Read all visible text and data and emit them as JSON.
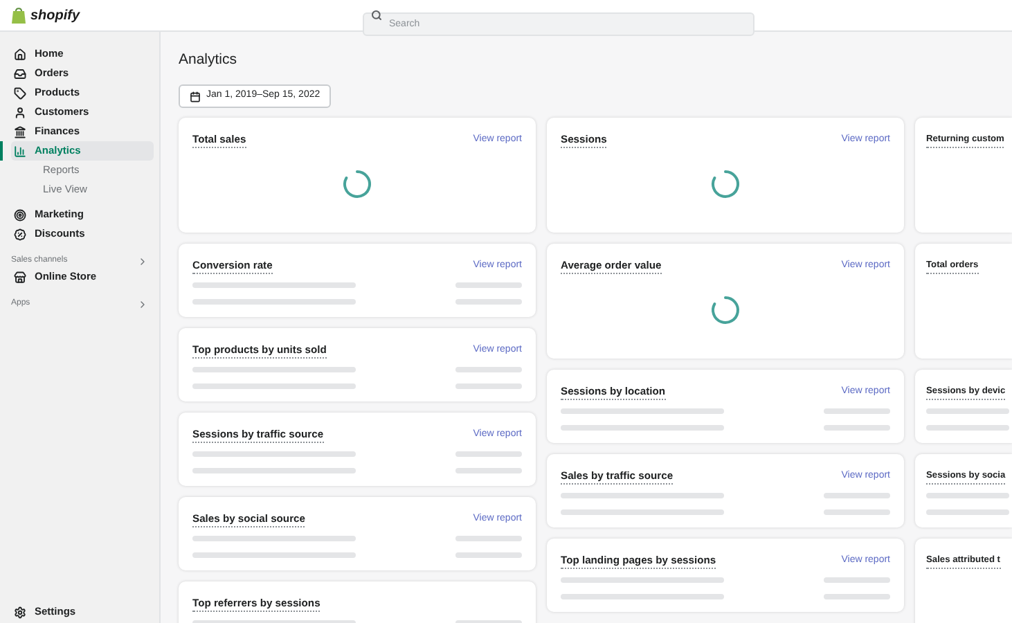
{
  "brand": "shopify",
  "search": {
    "placeholder": "Search"
  },
  "sidebar": {
    "items": [
      {
        "label": "Home",
        "selected": false
      },
      {
        "label": "Orders",
        "selected": false
      },
      {
        "label": "Products",
        "selected": false
      },
      {
        "label": "Customers",
        "selected": false
      },
      {
        "label": "Finances",
        "selected": false
      },
      {
        "label": "Analytics",
        "selected": true,
        "children": [
          {
            "label": "Reports"
          },
          {
            "label": "Live View"
          }
        ]
      },
      {
        "label": "Marketing",
        "selected": false
      },
      {
        "label": "Discounts",
        "selected": false
      }
    ],
    "sales_channels": {
      "label": "Sales channels",
      "items": [
        {
          "label": "Online Store"
        }
      ]
    },
    "apps": {
      "label": "Apps"
    },
    "settings": {
      "label": "Settings"
    }
  },
  "page": {
    "title": "Analytics",
    "date_range": "Jan 1, 2019–Sep 15, 2022"
  },
  "columns": [
    [
      {
        "title": "Total sales",
        "kind": "loading",
        "link": "View report"
      },
      {
        "title": "Conversion rate",
        "kind": "skeleton",
        "link": "View report"
      },
      {
        "title": "Top products by units sold",
        "kind": "skeleton",
        "link": "View report"
      },
      {
        "title": "Sessions by traffic source",
        "kind": "skeleton",
        "link": "View report"
      },
      {
        "title": "Sales by social source",
        "kind": "skeleton",
        "link": "View report"
      },
      {
        "title": "Top referrers by sessions",
        "kind": "skeleton"
      }
    ],
    [
      {
        "title": "Sessions",
        "kind": "loading",
        "link": "View report"
      },
      {
        "title": "Average order value",
        "kind": "loading",
        "link": "View report"
      },
      {
        "title": "Sessions by location",
        "kind": "skeleton",
        "link": "View report"
      },
      {
        "title": "Sales by traffic source",
        "kind": "skeleton",
        "link": "View report"
      },
      {
        "title": "Top landing pages by sessions",
        "kind": "skeleton",
        "link": "View report"
      }
    ],
    [
      {
        "title": "Returning custom",
        "kind": "blank"
      },
      {
        "title": "Total orders",
        "kind": "blank"
      },
      {
        "title": "Sessions by devic",
        "kind": "skeleton"
      },
      {
        "title": "Sessions by socia",
        "kind": "skeleton"
      },
      {
        "title": "Sales attributed t",
        "kind": "blank"
      }
    ]
  ]
}
